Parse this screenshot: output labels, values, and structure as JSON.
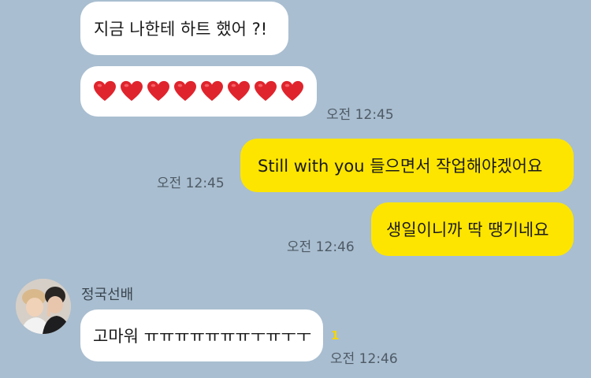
{
  "messages": [
    {
      "text": "지금 나한테 하트 했어 ?!"
    },
    {
      "hearts": 8,
      "time": "오전 12:45"
    },
    {
      "text": "Still with you 들으면서 작업해야겠어요",
      "time": "오전 12:45"
    },
    {
      "text": "생일이니까 딱 땡기네요",
      "time": "오전 12:46"
    },
    {
      "sender": "정국선배",
      "text": "고마워 ㅠㅠㅠㅠㅠㅠㅠㅜㅠㅜㅜ",
      "unread": "1",
      "time": "오전 12:46"
    }
  ],
  "colors": {
    "background": "#a9bed0",
    "incoming_bubble": "#ffffff",
    "outgoing_bubble": "#fee500",
    "heart": "#e0242d",
    "unread": "#f5d600"
  }
}
